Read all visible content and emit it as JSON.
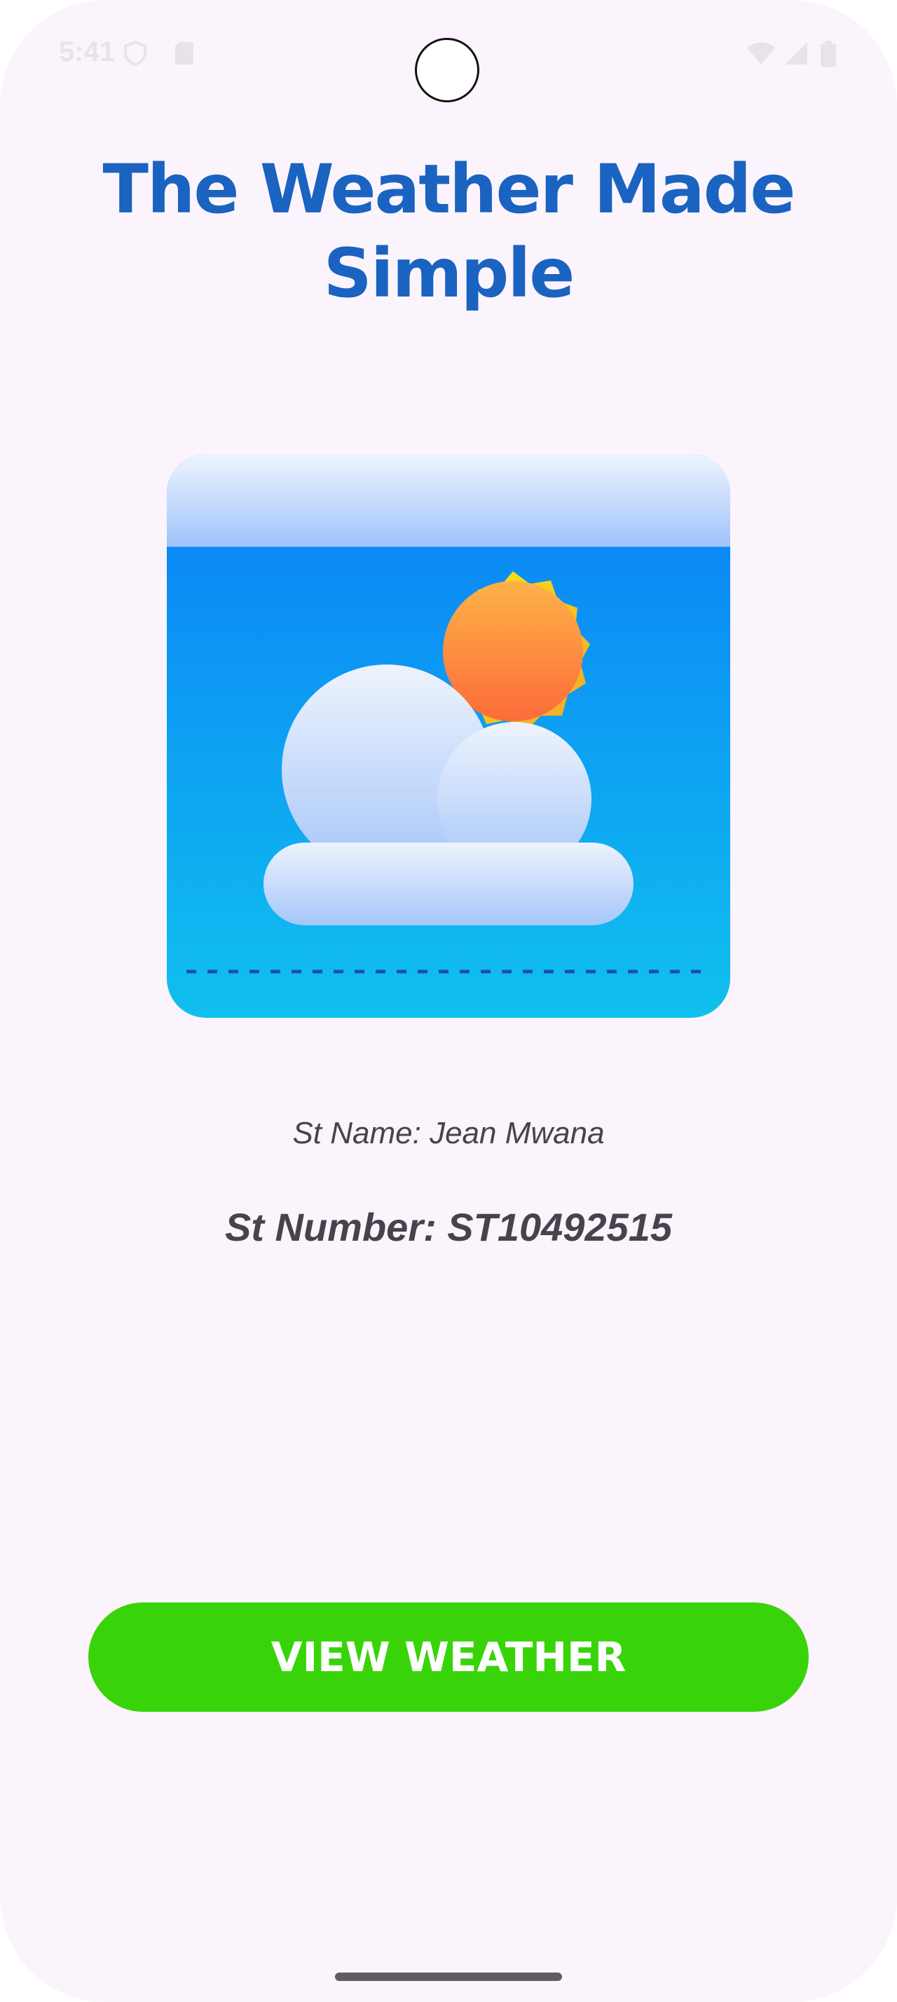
{
  "status_bar": {
    "time": "5:41"
  },
  "header": {
    "title": "The Weather Made Simple"
  },
  "illustration": {
    "icon": "weather-partly-cloudy-icon"
  },
  "student": {
    "name": "St Name: Jean Mwana",
    "number": "St Number: ST10492515"
  },
  "actions": {
    "view_weather_label": "VIEW WEATHER"
  },
  "colors": {
    "title": "#1a63c0",
    "button": "#38d409",
    "background": "#fcf4fc",
    "text": "#47434c"
  }
}
